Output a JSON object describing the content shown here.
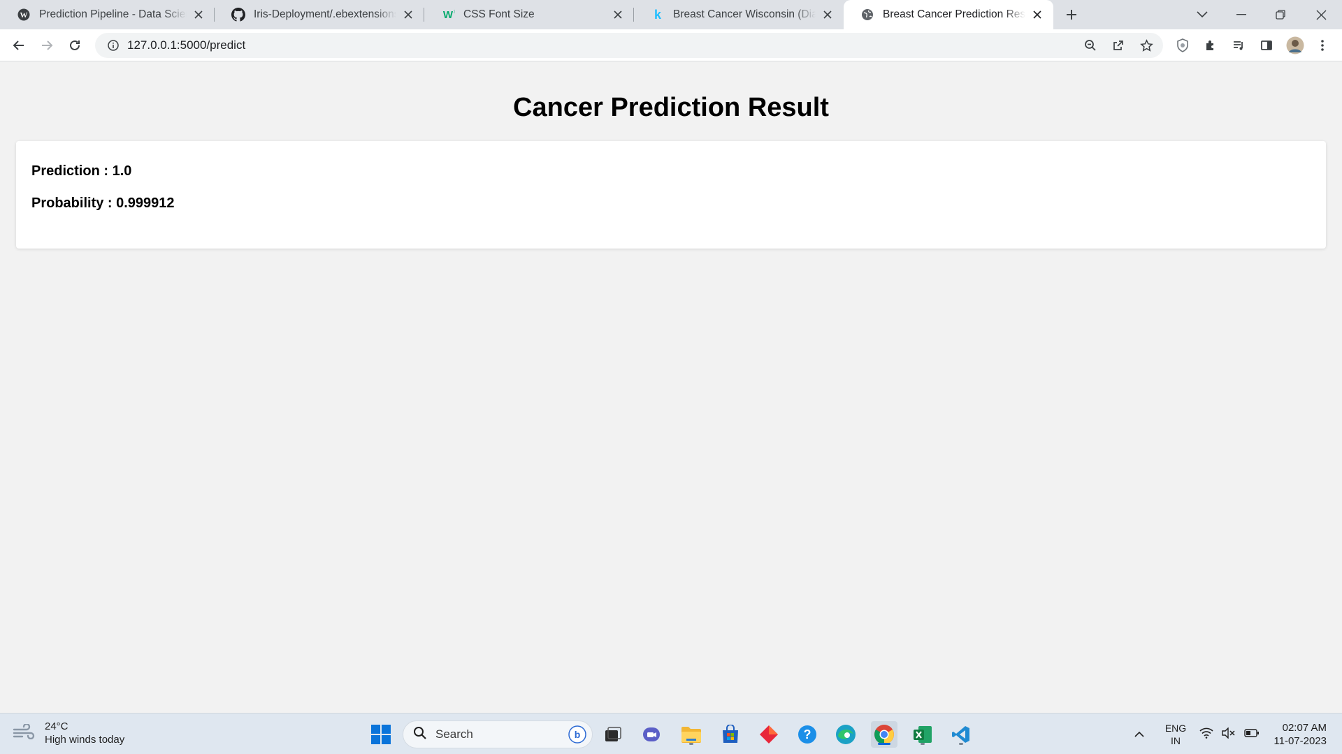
{
  "browser": {
    "tabs": [
      {
        "title": "Prediction Pipeline - Data Science",
        "icon": "wordpress-icon"
      },
      {
        "title": "Iris-Deployment/.ebextensions/python",
        "icon": "github-icon"
      },
      {
        "title": "CSS Font Size",
        "icon": "w3schools-icon"
      },
      {
        "title": "Breast Cancer Wisconsin (Diagnostic)",
        "icon": "kaggle-icon"
      },
      {
        "title": "Breast Cancer Prediction Result",
        "icon": "globe-icon"
      }
    ],
    "active_tab": 4,
    "url": "127.0.0.1:5000/predict"
  },
  "page": {
    "heading": "Cancer Prediction Result",
    "prediction_line": "Prediction : 1.0",
    "probability_line": "Probability : 0.999912"
  },
  "taskbar": {
    "weather_temp": "24°C",
    "weather_desc": "High winds today",
    "search_placeholder": "Search",
    "lang_top": "ENG",
    "lang_bottom": "IN",
    "time": "02:07 AM",
    "date": "11-07-2023"
  },
  "colors": {
    "page_bg": "#f2f2f2",
    "card_bg": "#ffffff",
    "tabstrip_bg": "#dee1e6",
    "taskbar_bg": "#dfe7f0"
  }
}
